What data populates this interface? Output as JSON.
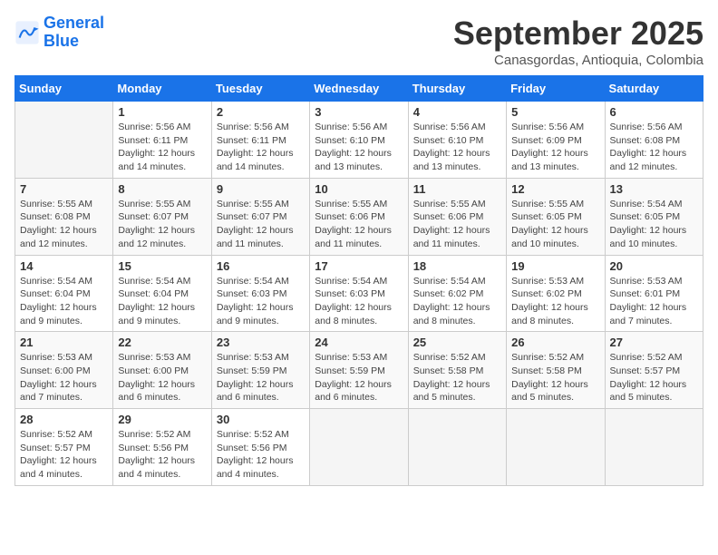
{
  "header": {
    "logo_line1": "General",
    "logo_line2": "Blue",
    "month": "September 2025",
    "location": "Canasgordas, Antioquia, Colombia"
  },
  "weekdays": [
    "Sunday",
    "Monday",
    "Tuesday",
    "Wednesday",
    "Thursday",
    "Friday",
    "Saturday"
  ],
  "weeks": [
    [
      {
        "day": "",
        "info": ""
      },
      {
        "day": "1",
        "info": "Sunrise: 5:56 AM\nSunset: 6:11 PM\nDaylight: 12 hours\nand 14 minutes."
      },
      {
        "day": "2",
        "info": "Sunrise: 5:56 AM\nSunset: 6:11 PM\nDaylight: 12 hours\nand 14 minutes."
      },
      {
        "day": "3",
        "info": "Sunrise: 5:56 AM\nSunset: 6:10 PM\nDaylight: 12 hours\nand 13 minutes."
      },
      {
        "day": "4",
        "info": "Sunrise: 5:56 AM\nSunset: 6:10 PM\nDaylight: 12 hours\nand 13 minutes."
      },
      {
        "day": "5",
        "info": "Sunrise: 5:56 AM\nSunset: 6:09 PM\nDaylight: 12 hours\nand 13 minutes."
      },
      {
        "day": "6",
        "info": "Sunrise: 5:56 AM\nSunset: 6:08 PM\nDaylight: 12 hours\nand 12 minutes."
      }
    ],
    [
      {
        "day": "7",
        "info": "Sunrise: 5:55 AM\nSunset: 6:08 PM\nDaylight: 12 hours\nand 12 minutes."
      },
      {
        "day": "8",
        "info": "Sunrise: 5:55 AM\nSunset: 6:07 PM\nDaylight: 12 hours\nand 12 minutes."
      },
      {
        "day": "9",
        "info": "Sunrise: 5:55 AM\nSunset: 6:07 PM\nDaylight: 12 hours\nand 11 minutes."
      },
      {
        "day": "10",
        "info": "Sunrise: 5:55 AM\nSunset: 6:06 PM\nDaylight: 12 hours\nand 11 minutes."
      },
      {
        "day": "11",
        "info": "Sunrise: 5:55 AM\nSunset: 6:06 PM\nDaylight: 12 hours\nand 11 minutes."
      },
      {
        "day": "12",
        "info": "Sunrise: 5:55 AM\nSunset: 6:05 PM\nDaylight: 12 hours\nand 10 minutes."
      },
      {
        "day": "13",
        "info": "Sunrise: 5:54 AM\nSunset: 6:05 PM\nDaylight: 12 hours\nand 10 minutes."
      }
    ],
    [
      {
        "day": "14",
        "info": "Sunrise: 5:54 AM\nSunset: 6:04 PM\nDaylight: 12 hours\nand 9 minutes."
      },
      {
        "day": "15",
        "info": "Sunrise: 5:54 AM\nSunset: 6:04 PM\nDaylight: 12 hours\nand 9 minutes."
      },
      {
        "day": "16",
        "info": "Sunrise: 5:54 AM\nSunset: 6:03 PM\nDaylight: 12 hours\nand 9 minutes."
      },
      {
        "day": "17",
        "info": "Sunrise: 5:54 AM\nSunset: 6:03 PM\nDaylight: 12 hours\nand 8 minutes."
      },
      {
        "day": "18",
        "info": "Sunrise: 5:54 AM\nSunset: 6:02 PM\nDaylight: 12 hours\nand 8 minutes."
      },
      {
        "day": "19",
        "info": "Sunrise: 5:53 AM\nSunset: 6:02 PM\nDaylight: 12 hours\nand 8 minutes."
      },
      {
        "day": "20",
        "info": "Sunrise: 5:53 AM\nSunset: 6:01 PM\nDaylight: 12 hours\nand 7 minutes."
      }
    ],
    [
      {
        "day": "21",
        "info": "Sunrise: 5:53 AM\nSunset: 6:00 PM\nDaylight: 12 hours\nand 7 minutes."
      },
      {
        "day": "22",
        "info": "Sunrise: 5:53 AM\nSunset: 6:00 PM\nDaylight: 12 hours\nand 6 minutes."
      },
      {
        "day": "23",
        "info": "Sunrise: 5:53 AM\nSunset: 5:59 PM\nDaylight: 12 hours\nand 6 minutes."
      },
      {
        "day": "24",
        "info": "Sunrise: 5:53 AM\nSunset: 5:59 PM\nDaylight: 12 hours\nand 6 minutes."
      },
      {
        "day": "25",
        "info": "Sunrise: 5:52 AM\nSunset: 5:58 PM\nDaylight: 12 hours\nand 5 minutes."
      },
      {
        "day": "26",
        "info": "Sunrise: 5:52 AM\nSunset: 5:58 PM\nDaylight: 12 hours\nand 5 minutes."
      },
      {
        "day": "27",
        "info": "Sunrise: 5:52 AM\nSunset: 5:57 PM\nDaylight: 12 hours\nand 5 minutes."
      }
    ],
    [
      {
        "day": "28",
        "info": "Sunrise: 5:52 AM\nSunset: 5:57 PM\nDaylight: 12 hours\nand 4 minutes."
      },
      {
        "day": "29",
        "info": "Sunrise: 5:52 AM\nSunset: 5:56 PM\nDaylight: 12 hours\nand 4 minutes."
      },
      {
        "day": "30",
        "info": "Sunrise: 5:52 AM\nSunset: 5:56 PM\nDaylight: 12 hours\nand 4 minutes."
      },
      {
        "day": "",
        "info": ""
      },
      {
        "day": "",
        "info": ""
      },
      {
        "day": "",
        "info": ""
      },
      {
        "day": "",
        "info": ""
      }
    ]
  ]
}
